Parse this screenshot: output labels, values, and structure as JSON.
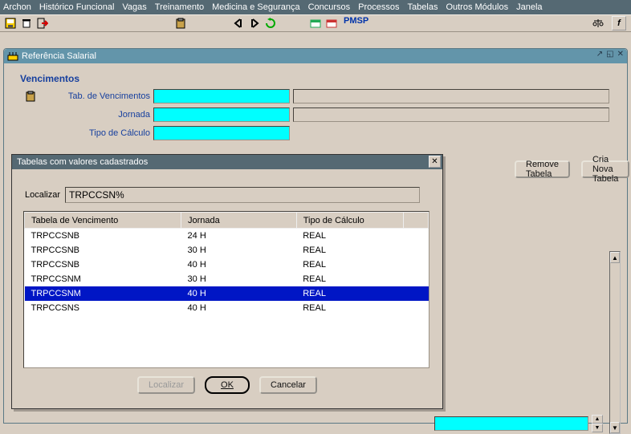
{
  "menubar": [
    "Archon",
    "Histórico Funcional",
    "Vagas",
    "Treinamento",
    "Medicina e Segurança",
    "Concursos",
    "Processos",
    "Tabelas",
    "Outros Módulos",
    "Janela"
  ],
  "toolbar": {
    "pmsp": "PMSP"
  },
  "window": {
    "title": "Referência Salarial",
    "section": "Vencimentos",
    "fields": {
      "tab": "Tab. de Vencimentos",
      "jornada": "Jornada",
      "tipo": "Tipo de Cálculo"
    },
    "buttons": {
      "remove": "Remove Tabela",
      "nova": "Cria Nova Tabela"
    }
  },
  "dialog": {
    "title": "Tabelas com valores cadastrados",
    "find_label": "Localizar",
    "find_value": "TRPCCSN%",
    "cols": {
      "tab": "Tabela de Vencimento",
      "jornada": "Jornada",
      "tipo": "Tipo de Cálculo"
    },
    "rows": [
      {
        "tab": "TRPCCSNB",
        "jornada": "24 H",
        "tipo": "REAL",
        "sel": false
      },
      {
        "tab": "TRPCCSNB",
        "jornada": "30 H",
        "tipo": "REAL",
        "sel": false
      },
      {
        "tab": "TRPCCSNB",
        "jornada": "40 H",
        "tipo": "REAL",
        "sel": false
      },
      {
        "tab": "TRPCCSNM",
        "jornada": "30 H",
        "tipo": "REAL",
        "sel": false
      },
      {
        "tab": "TRPCCSNM",
        "jornada": "40 H",
        "tipo": "REAL",
        "sel": true
      },
      {
        "tab": "TRPCCSNS",
        "jornada": "40 H",
        "tipo": "REAL",
        "sel": false
      }
    ],
    "buttons": {
      "localizar": "Localizar",
      "ok": "OK",
      "cancelar": "Cancelar"
    }
  }
}
